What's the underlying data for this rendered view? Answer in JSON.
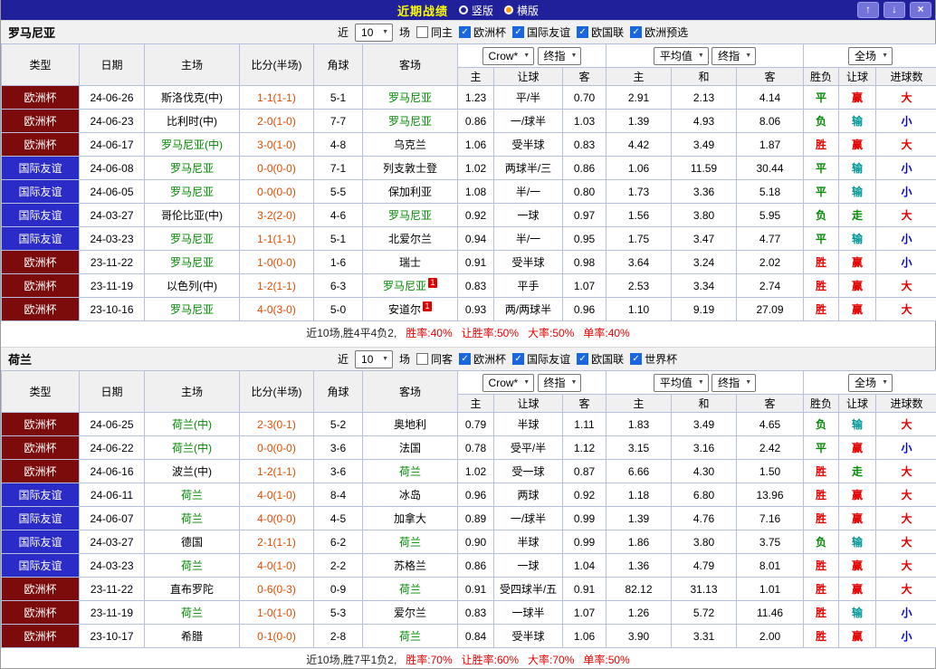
{
  "titlebar": {
    "title": "近期战绩",
    "view_options": [
      {
        "label": "竖版",
        "selected": false
      },
      {
        "label": "横版",
        "selected": true
      }
    ],
    "icons": {
      "up_icon": "↑",
      "down_icon": "↓",
      "close_icon": "×"
    }
  },
  "table_headers": {
    "type": "类型",
    "date": "日期",
    "home": "主场",
    "score": "比分(半场)",
    "corner": "角球",
    "away": "客场",
    "asia_selects": [
      "Crow*",
      "终指"
    ],
    "euro_selects": [
      "平均值",
      "终指"
    ],
    "scope_select": "全场",
    "asia_cols": [
      "主",
      "让球",
      "客"
    ],
    "euro_cols": [
      "主",
      "和",
      "客"
    ],
    "result_cols": [
      "胜负",
      "让球",
      "进球数"
    ]
  },
  "colors": {
    "league": {
      "欧洲杯": "#7c0c0c",
      "国际友谊": "#2b2bc8"
    },
    "values": {
      "胜": "#e60000",
      "平": "#008b00",
      "负": "#008b00",
      "赢": "#e60000",
      "输": "#009595",
      "走": "#008b00",
      "大": "#e60000",
      "小": "#0000dd"
    },
    "focus_team": "#008800",
    "score": "#dd4b00"
  },
  "sections": [
    {
      "team": "罗马尼亚",
      "filter": {
        "recent_prefix": "近",
        "recent_count": "10",
        "recent_suffix": "场",
        "checkboxes": [
          {
            "label": "同主",
            "checked": false
          },
          {
            "label": "欧洲杯",
            "checked": true
          },
          {
            "label": "国际友谊",
            "checked": true
          },
          {
            "label": "欧国联",
            "checked": true
          },
          {
            "label": "欧洲预选",
            "checked": true
          }
        ]
      },
      "rows": [
        {
          "league": "欧洲杯",
          "date": "24-06-26",
          "home": "斯洛伐克(中)",
          "score": "1-1(1-1)",
          "corner": "5-1",
          "away": "罗马尼亚",
          "asia": [
            "1.23",
            "平/半",
            "0.70"
          ],
          "euro": [
            "2.91",
            "2.13",
            "4.14"
          ],
          "result": "平",
          "hcp": "赢",
          "goals": "大"
        },
        {
          "league": "欧洲杯",
          "date": "24-06-23",
          "home": "比利时(中)",
          "score": "2-0(1-0)",
          "corner": "7-7",
          "away": "罗马尼亚",
          "asia": [
            "0.86",
            "一/球半",
            "1.03"
          ],
          "euro": [
            "1.39",
            "4.93",
            "8.06"
          ],
          "result": "负",
          "hcp": "输",
          "goals": "小"
        },
        {
          "league": "欧洲杯",
          "date": "24-06-17",
          "home": "罗马尼亚(中)",
          "score": "3-0(1-0)",
          "corner": "4-8",
          "away": "乌克兰",
          "asia": [
            "1.06",
            "受半球",
            "0.83"
          ],
          "euro": [
            "4.42",
            "3.49",
            "1.87"
          ],
          "result": "胜",
          "hcp": "赢",
          "goals": "大"
        },
        {
          "league": "国际友谊",
          "date": "24-06-08",
          "home": "罗马尼亚",
          "score": "0-0(0-0)",
          "corner": "7-1",
          "away": "列支敦士登",
          "asia": [
            "1.02",
            "两球半/三",
            "0.86"
          ],
          "euro": [
            "1.06",
            "11.59",
            "30.44"
          ],
          "result": "平",
          "hcp": "输",
          "goals": "小"
        },
        {
          "league": "国际友谊",
          "date": "24-06-05",
          "home": "罗马尼亚",
          "score": "0-0(0-0)",
          "corner": "5-5",
          "away": "保加利亚",
          "asia": [
            "1.08",
            "半/一",
            "0.80"
          ],
          "euro": [
            "1.73",
            "3.36",
            "5.18"
          ],
          "result": "平",
          "hcp": "输",
          "goals": "小"
        },
        {
          "league": "国际友谊",
          "date": "24-03-27",
          "home": "哥伦比亚(中)",
          "score": "3-2(2-0)",
          "corner": "4-6",
          "away": "罗马尼亚",
          "asia": [
            "0.92",
            "一球",
            "0.97"
          ],
          "euro": [
            "1.56",
            "3.80",
            "5.95"
          ],
          "result": "负",
          "hcp": "走",
          "goals": "大"
        },
        {
          "league": "国际友谊",
          "date": "24-03-23",
          "home": "罗马尼亚",
          "score": "1-1(1-1)",
          "corner": "5-1",
          "away": "北爱尔兰",
          "asia": [
            "0.94",
            "半/一",
            "0.95"
          ],
          "euro": [
            "1.75",
            "3.47",
            "4.77"
          ],
          "result": "平",
          "hcp": "输",
          "goals": "小"
        },
        {
          "league": "欧洲杯",
          "date": "23-11-22",
          "home": "罗马尼亚",
          "score": "1-0(0-0)",
          "corner": "1-6",
          "away": "瑞士",
          "asia": [
            "0.91",
            "受半球",
            "0.98"
          ],
          "euro": [
            "3.64",
            "3.24",
            "2.02"
          ],
          "result": "胜",
          "hcp": "赢",
          "goals": "小"
        },
        {
          "league": "欧洲杯",
          "date": "23-11-19",
          "home": "以色列(中)",
          "score": "1-2(1-1)",
          "corner": "6-3",
          "away": "罗马尼亚",
          "away_card": "1",
          "asia": [
            "0.83",
            "平手",
            "1.07"
          ],
          "euro": [
            "2.53",
            "3.34",
            "2.74"
          ],
          "result": "胜",
          "hcp": "赢",
          "goals": "大"
        },
        {
          "league": "欧洲杯",
          "date": "23-10-16",
          "home": "罗马尼亚",
          "score": "4-0(3-0)",
          "corner": "5-0",
          "away": "安道尔",
          "away_card": "1",
          "asia": [
            "0.93",
            "两/两球半",
            "0.96"
          ],
          "euro": [
            "1.10",
            "9.19",
            "27.09"
          ],
          "result": "胜",
          "hcp": "赢",
          "goals": "大"
        }
      ],
      "summary": {
        "intro": "近10场,胜4平4负2,",
        "stats": [
          "胜率:40%",
          "让胜率:50%",
          "大率:50%",
          "单率:40%"
        ]
      }
    },
    {
      "team": "荷兰",
      "filter": {
        "recent_prefix": "近",
        "recent_count": "10",
        "recent_suffix": "场",
        "checkboxes": [
          {
            "label": "同客",
            "checked": false
          },
          {
            "label": "欧洲杯",
            "checked": true
          },
          {
            "label": "国际友谊",
            "checked": true
          },
          {
            "label": "欧国联",
            "checked": true
          },
          {
            "label": "世界杯",
            "checked": true
          }
        ]
      },
      "rows": [
        {
          "league": "欧洲杯",
          "date": "24-06-25",
          "home": "荷兰(中)",
          "score": "2-3(0-1)",
          "corner": "5-2",
          "away": "奥地利",
          "asia": [
            "0.79",
            "半球",
            "1.11"
          ],
          "euro": [
            "1.83",
            "3.49",
            "4.65"
          ],
          "result": "负",
          "hcp": "输",
          "goals": "大"
        },
        {
          "league": "欧洲杯",
          "date": "24-06-22",
          "home": "荷兰(中)",
          "score": "0-0(0-0)",
          "corner": "3-6",
          "away": "法国",
          "asia": [
            "0.78",
            "受平/半",
            "1.12"
          ],
          "euro": [
            "3.15",
            "3.16",
            "2.42"
          ],
          "result": "平",
          "hcp": "赢",
          "goals": "小"
        },
        {
          "league": "欧洲杯",
          "date": "24-06-16",
          "home": "波兰(中)",
          "score": "1-2(1-1)",
          "corner": "3-6",
          "away": "荷兰",
          "asia": [
            "1.02",
            "受一球",
            "0.87"
          ],
          "euro": [
            "6.66",
            "4.30",
            "1.50"
          ],
          "result": "胜",
          "hcp": "走",
          "goals": "大"
        },
        {
          "league": "国际友谊",
          "date": "24-06-11",
          "home": "荷兰",
          "score": "4-0(1-0)",
          "corner": "8-4",
          "away": "冰岛",
          "asia": [
            "0.96",
            "两球",
            "0.92"
          ],
          "euro": [
            "1.18",
            "6.80",
            "13.96"
          ],
          "result": "胜",
          "hcp": "赢",
          "goals": "大"
        },
        {
          "league": "国际友谊",
          "date": "24-06-07",
          "home": "荷兰",
          "score": "4-0(0-0)",
          "corner": "4-5",
          "away": "加拿大",
          "asia": [
            "0.89",
            "一/球半",
            "0.99"
          ],
          "euro": [
            "1.39",
            "4.76",
            "7.16"
          ],
          "result": "胜",
          "hcp": "赢",
          "goals": "大"
        },
        {
          "league": "国际友谊",
          "date": "24-03-27",
          "home": "德国",
          "score": "2-1(1-1)",
          "corner": "6-2",
          "away": "荷兰",
          "asia": [
            "0.90",
            "半球",
            "0.99"
          ],
          "euro": [
            "1.86",
            "3.80",
            "3.75"
          ],
          "result": "负",
          "hcp": "输",
          "goals": "大"
        },
        {
          "league": "国际友谊",
          "date": "24-03-23",
          "home": "荷兰",
          "score": "4-0(1-0)",
          "corner": "2-2",
          "away": "苏格兰",
          "asia": [
            "0.86",
            "一球",
            "1.04"
          ],
          "euro": [
            "1.36",
            "4.79",
            "8.01"
          ],
          "result": "胜",
          "hcp": "赢",
          "goals": "大"
        },
        {
          "league": "欧洲杯",
          "date": "23-11-22",
          "home": "直布罗陀",
          "score": "0-6(0-3)",
          "corner": "0-9",
          "away": "荷兰",
          "asia": [
            "0.91",
            "受四球半/五",
            "0.91"
          ],
          "euro": [
            "82.12",
            "31.13",
            "1.01"
          ],
          "result": "胜",
          "hcp": "赢",
          "goals": "大"
        },
        {
          "league": "欧洲杯",
          "date": "23-11-19",
          "home": "荷兰",
          "score": "1-0(1-0)",
          "corner": "5-3",
          "away": "爱尔兰",
          "asia": [
            "0.83",
            "一球半",
            "1.07"
          ],
          "euro": [
            "1.26",
            "5.72",
            "11.46"
          ],
          "result": "胜",
          "hcp": "输",
          "goals": "小"
        },
        {
          "league": "欧洲杯",
          "date": "23-10-17",
          "home": "希腊",
          "score": "0-1(0-0)",
          "corner": "2-8",
          "away": "荷兰",
          "asia": [
            "0.84",
            "受半球",
            "1.06"
          ],
          "euro": [
            "3.90",
            "3.31",
            "2.00"
          ],
          "result": "胜",
          "hcp": "赢",
          "goals": "小"
        }
      ],
      "summary": {
        "intro": "近10场,胜7平1负2,",
        "stats": [
          "胜率:70%",
          "让胜率:60%",
          "大率:70%",
          "单率:50%"
        ]
      }
    }
  ]
}
